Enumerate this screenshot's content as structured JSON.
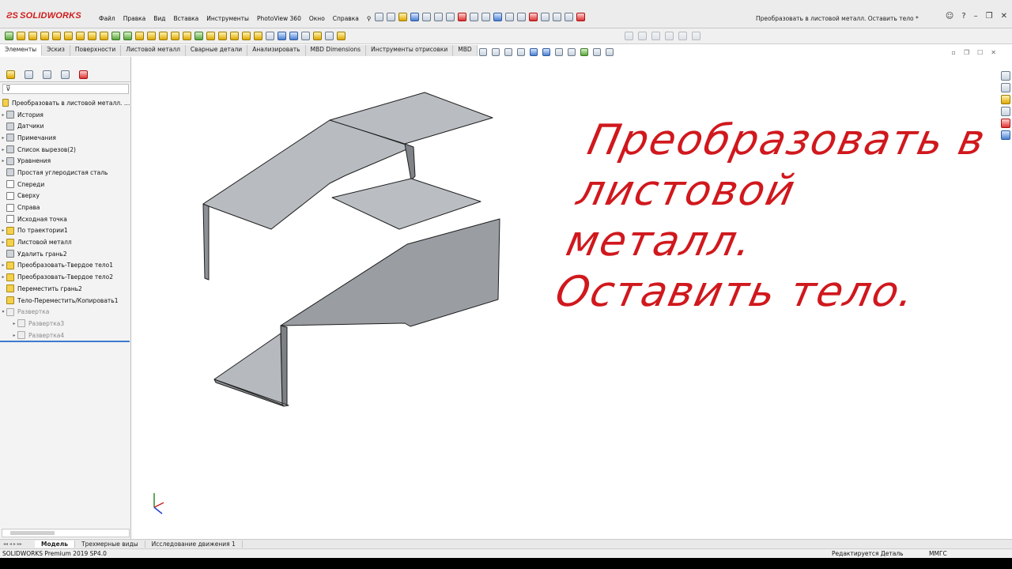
{
  "app": {
    "logo": "SOLIDWORKS",
    "document_title": "Преобразовать в листовой металл. Оставить тело *"
  },
  "menu": [
    "Файл",
    "Правка",
    "Вид",
    "Вставка",
    "Инструменты",
    "PhotoView 360",
    "Окно",
    "Справка"
  ],
  "command_tabs": [
    "Элементы",
    "Эскиз",
    "Поверхности",
    "Листовой металл",
    "Сварные детали",
    "Анализировать",
    "MBD Dimensions",
    "Инструменты отрисовки",
    "MBD"
  ],
  "active_command_tab": "Элементы",
  "feature_tree": {
    "root": "Преобразовать в листовой металл. Оставить тело",
    "items": [
      {
        "label": "История",
        "expandable": true,
        "icon": "history-icon"
      },
      {
        "label": "Датчики",
        "expandable": false,
        "icon": "sensor-icon"
      },
      {
        "label": "Примечания",
        "expandable": true,
        "icon": "annotations-icon"
      },
      {
        "label": "Список вырезов(2)",
        "expandable": true,
        "icon": "cut-list-icon"
      },
      {
        "label": "Уравнения",
        "expandable": true,
        "icon": "equations-icon"
      },
      {
        "label": "Простая углеродистая сталь",
        "expandable": false,
        "icon": "material-icon"
      },
      {
        "label": "Спереди",
        "expandable": false,
        "icon": "plane-icon"
      },
      {
        "label": "Сверху",
        "expandable": false,
        "icon": "plane-icon"
      },
      {
        "label": "Справа",
        "expandable": false,
        "icon": "plane-icon"
      },
      {
        "label": "Исходная точка",
        "expandable": false,
        "icon": "origin-icon"
      },
      {
        "label": "По траектории1",
        "expandable": true,
        "icon": "sweep-icon"
      },
      {
        "label": "Листовой металл",
        "expandable": true,
        "icon": "sheet-metal-icon"
      },
      {
        "label": "Удалить грань2",
        "expandable": false,
        "icon": "delete-face-icon"
      },
      {
        "label": "Преобразовать-Твердое тело1",
        "expandable": true,
        "icon": "convert-solid-icon"
      },
      {
        "label": "Преобразовать-Твердое тело2",
        "expandable": true,
        "icon": "convert-solid-icon"
      },
      {
        "label": "Переместить грань2",
        "expandable": false,
        "icon": "move-face-icon"
      },
      {
        "label": "Тело-Переместить/Копировать1",
        "expandable": false,
        "icon": "move-body-icon"
      },
      {
        "label": "Развертка",
        "expandable": true,
        "expanded": true,
        "icon": "flat-pattern-icon",
        "dim": true
      },
      {
        "label": "Развертка3",
        "expandable": true,
        "icon": "flat-pattern-icon",
        "dim": true,
        "indent": true
      },
      {
        "label": "Развертка4",
        "expandable": true,
        "icon": "flat-pattern-icon",
        "dim": true,
        "indent": true
      }
    ]
  },
  "annotation_text": {
    "line1": "Преобразовать в",
    "line2": "листовой металл.",
    "line3": "Оставить тело."
  },
  "bottom_tabs": [
    "Модель",
    "Трехмерные виды",
    "Исследование движения 1"
  ],
  "active_bottom_tab": "Модель",
  "status": {
    "version": "SOLIDWORKS Premium 2019 SP4.0",
    "mode": "Редактируется Деталь",
    "units": "ММГС"
  },
  "colors": {
    "annotation": "#d0181d",
    "model_face": "#b5b9bd",
    "model_edge": "#1e1e1e"
  }
}
